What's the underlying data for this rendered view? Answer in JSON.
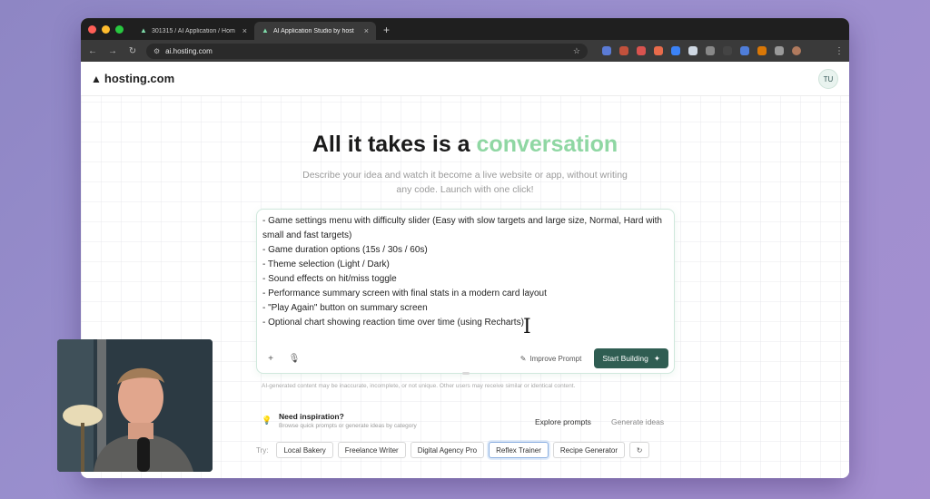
{
  "browser": {
    "tabs": [
      {
        "title": "301315 / AI Application / Hom",
        "active": false
      },
      {
        "title": "AI Application Studio by host",
        "active": true
      }
    ],
    "new_tab": "+",
    "url": "ai.hosting.com"
  },
  "header": {
    "logo_text": "hosting.com",
    "avatar_initials": "TU"
  },
  "hero": {
    "title_prefix": "All it takes is a ",
    "title_accent": "conversation",
    "subtitle": "Describe your idea and watch it become a live website or app, without writing any code. Launch with one click!"
  },
  "prompt": {
    "text": "- Game settings menu with difficulty slider (Easy with slow targets and large size, Normal, Hard with small and fast targets)\n- Game duration options (15s / 30s / 60s)\n- Theme selection (Light / Dark)\n- Sound effects on hit/miss toggle\n- Performance summary screen with final stats in a modern card layout\n- \"Play Again\" button on summary screen\n- Optional chart showing reaction time over time (using Recharts)",
    "add_icon": "+",
    "mic_icon": "🎙",
    "improve_label": "Improve Prompt",
    "start_label": "Start Building"
  },
  "disclaimer": "AI-generated content may be inaccurate, incomplete, or not unique. Other users may receive similar or identical content.",
  "inspiration": {
    "title": "Need inspiration?",
    "subtitle": "Browse quick prompts or generate ideas by category",
    "tabs": [
      "Explore prompts",
      "Generate ideas"
    ]
  },
  "try": {
    "label": "Try:",
    "chips": [
      "Local Bakery",
      "Freelance Writer",
      "Digital Agency Pro",
      "Reflex Trainer",
      "Recipe Generator"
    ],
    "selected": "Reflex Trainer"
  },
  "colors": {
    "accent": "#8fd7a3",
    "primary_button": "#2f5d52",
    "tab_strip": "#1f1f1f",
    "toolbar": "#3a3a3a"
  }
}
